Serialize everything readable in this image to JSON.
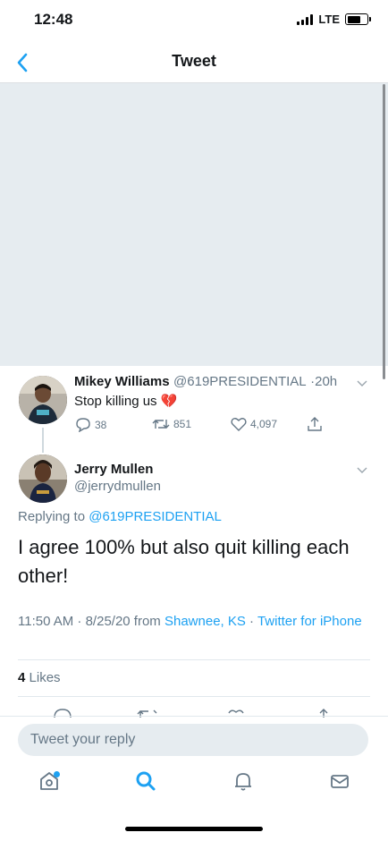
{
  "status": {
    "time": "12:48",
    "network": "LTE",
    "battery_level": 0.7
  },
  "header": {
    "title": "Tweet"
  },
  "parent_tweet": {
    "name": "Mikey Williams",
    "handle": "@619PRESIDENTIAL",
    "time": "20h",
    "text": "Stop killing us",
    "emoji": "💔",
    "replies": "38",
    "retweets": "851",
    "likes": "4,097"
  },
  "reply_tweet": {
    "name": "Jerry Mullen",
    "handle": "@jerrydmullen",
    "replying_prefix": "Replying to ",
    "replying_to": "@619PRESIDENTIAL",
    "text": "I agree 100% but also quit killing each other!",
    "timestamp": "11:50 AM · 8/25/20 from ",
    "location": "Shawnee, KS",
    "separator": " · ",
    "client": "Twitter for iPhone",
    "like_count": "4",
    "like_label": "Likes"
  },
  "reply_box": {
    "placeholder": "Tweet your reply"
  },
  "tabs": [
    "home-icon",
    "search-icon",
    "notifications-icon",
    "messages-icon"
  ],
  "colors": {
    "accent": "#1da1f2",
    "muted": "#657786",
    "placeholder_bg": "#e6ecf0"
  }
}
